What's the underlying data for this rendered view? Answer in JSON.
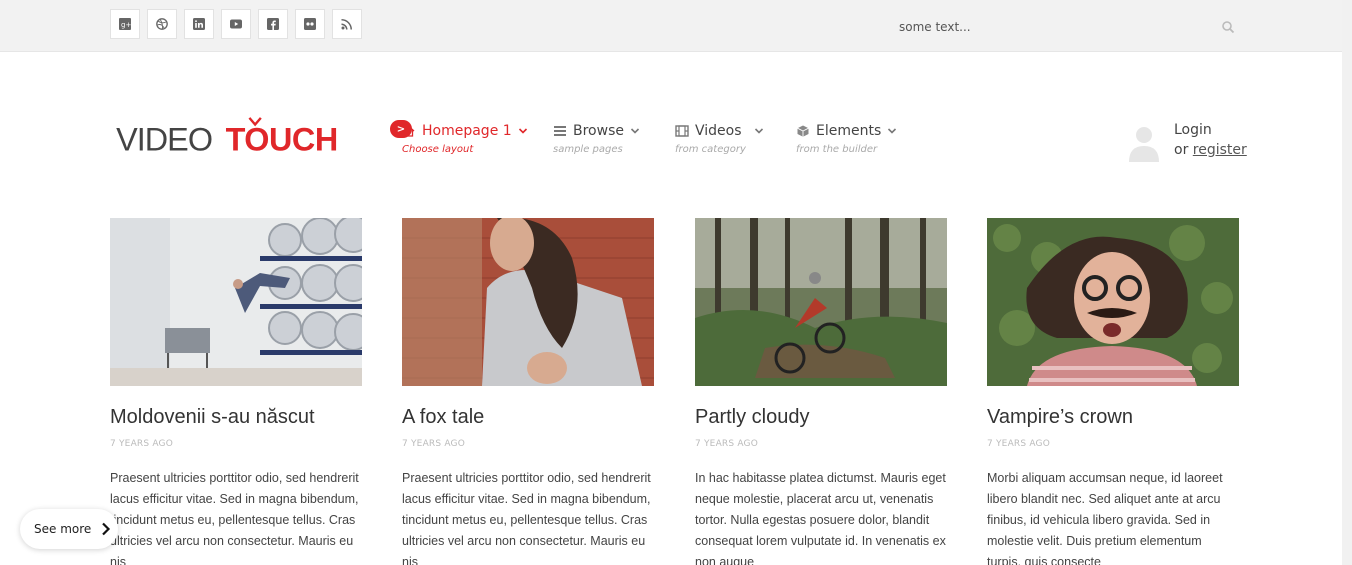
{
  "topbar": {
    "social_icons": [
      "google-plus-icon",
      "dribbble-icon",
      "linkedin-icon",
      "youtube-icon",
      "facebook-icon",
      "flickr-icon",
      "rss-icon"
    ],
    "search": {
      "placeholder": "some text..."
    }
  },
  "logo": {
    "part1": "VIDEO",
    "part2": "TOUCH"
  },
  "nav": [
    {
      "label": "Homepage 1",
      "sub": "Choose layout",
      "icon": "home-icon",
      "active": true
    },
    {
      "label": "Browse",
      "sub": "sample pages",
      "icon": "list-icon",
      "active": false
    },
    {
      "label": "Videos",
      "sub": "from category",
      "icon": "film-icon",
      "active": false
    },
    {
      "label": "Elements",
      "sub": "from the builder",
      "icon": "cube-icon",
      "active": false
    }
  ],
  "login": {
    "login_label": "Login",
    "or": "or",
    "register_label": "register"
  },
  "cards": [
    {
      "title": "Moldovenii s-au născut",
      "meta": "7 YEARS AGO",
      "excerpt": "Praesent ultricies porttitor odio, sed hendrerit lacus efficitur vitae. Sed in magna bibendum, tincidunt metus eu, pellentesque tellus. Cras ultricies vel arcu non consectetur. Mauris eu nis"
    },
    {
      "title": "A fox tale",
      "meta": "7 YEARS AGO",
      "excerpt": "Praesent ultricies porttitor odio, sed hendrerit lacus efficitur vitae. Sed in magna bibendum, tincidunt metus eu, pellentesque tellus. Cras ultricies vel arcu non consectetur. Mauris eu nis"
    },
    {
      "title": "Partly cloudy",
      "meta": "7 YEARS AGO",
      "excerpt": "In hac habitasse platea dictumst. Mauris eget neque molestie, placerat arcu ut, venenatis tortor. Nulla egestas posuere dolor, blandit consequat lorem vulputate id. In venenatis ex non augue"
    },
    {
      "title": "Vampire’s crown",
      "meta": "7 YEARS AGO",
      "excerpt": "Morbi aliquam accumsan neque, id laoreet libero blandit nec. Sed aliquet ante at arcu finibus, id vehicula libero gravida. Sed in molestie velit. Duis pretium elementum turpis, quis consecte"
    }
  ],
  "see_more": {
    "label": "See more"
  },
  "colors": {
    "accent": "#e0272a",
    "topbar_bg": "#f2f2f2"
  }
}
